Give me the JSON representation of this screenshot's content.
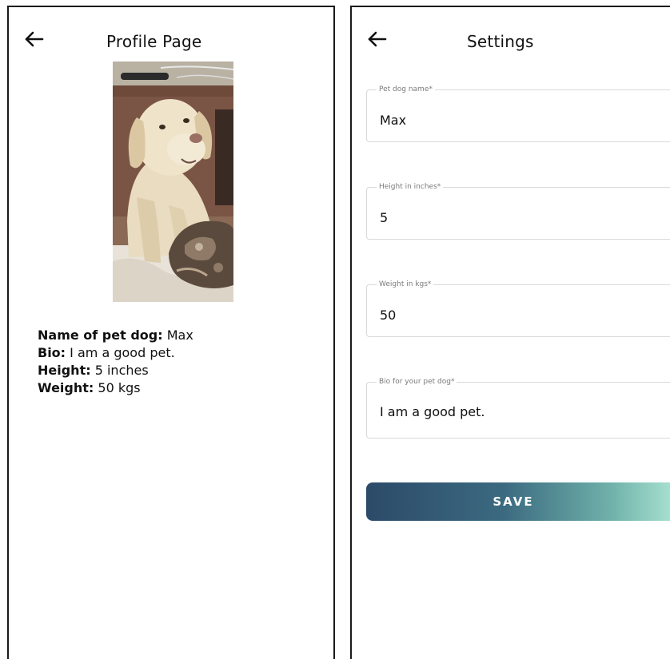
{
  "profile_screen": {
    "title": "Profile Page",
    "back_icon": "arrow-left-icon",
    "photo": "dog-photo",
    "info": [
      {
        "label": "Name of pet dog:",
        "value": " Max"
      },
      {
        "label": "Bio:",
        "value": " I am a good pet."
      },
      {
        "label": "Height:",
        "value": " 5 inches"
      },
      {
        "label": "Weight:",
        "value": " 50 kgs"
      }
    ]
  },
  "settings_screen": {
    "title": "Settings",
    "back_icon": "arrow-left-icon",
    "fields": [
      {
        "label": "Pet dog name*",
        "value": "Max"
      },
      {
        "label": "Height in inches*",
        "value": "5"
      },
      {
        "label": "Weight in kgs*",
        "value": "50"
      },
      {
        "label": "Bio for your pet dog*",
        "value": "I am a good pet."
      }
    ],
    "save_label": "SAVE"
  },
  "colors": {
    "save_gradient_start": "#2c4a69",
    "save_gradient_end": "#a6e0cf",
    "border": "#1a1a1a",
    "field_border": "#d9d9d9"
  }
}
